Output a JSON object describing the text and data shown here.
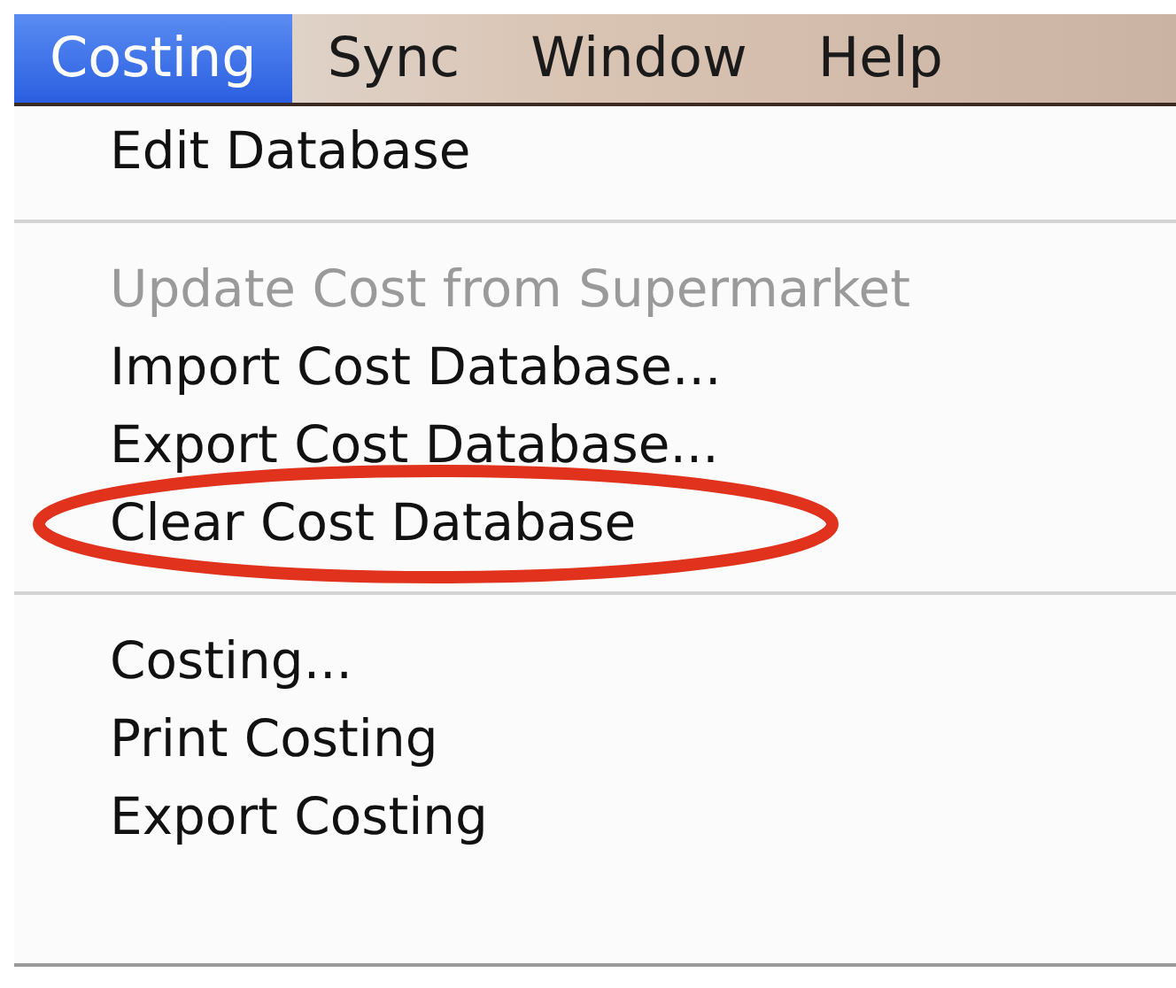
{
  "menu_bar": [
    {
      "label": "Costing",
      "selected": true
    },
    {
      "label": "Sync",
      "selected": false
    },
    {
      "label": "Window",
      "selected": false
    },
    {
      "label": "Help",
      "selected": false
    }
  ],
  "menu": {
    "items": [
      {
        "kind": "item",
        "label": "Edit Database",
        "disabled": false,
        "circled": false
      },
      {
        "kind": "separator"
      },
      {
        "kind": "item",
        "label": "Update Cost from Supermarket",
        "disabled": true,
        "circled": false
      },
      {
        "kind": "item",
        "label": "Import Cost Database...",
        "disabled": false,
        "circled": false
      },
      {
        "kind": "item",
        "label": "Export Cost Database...",
        "disabled": false,
        "circled": false
      },
      {
        "kind": "item",
        "label": "Clear Cost Database",
        "disabled": false,
        "circled": true
      },
      {
        "kind": "separator"
      },
      {
        "kind": "item",
        "label": "Costing...",
        "disabled": false,
        "circled": false
      },
      {
        "kind": "item",
        "label": "Print Costing",
        "disabled": false,
        "circled": false
      },
      {
        "kind": "item",
        "label": "Export Costing",
        "disabled": false,
        "circled": false
      }
    ]
  }
}
